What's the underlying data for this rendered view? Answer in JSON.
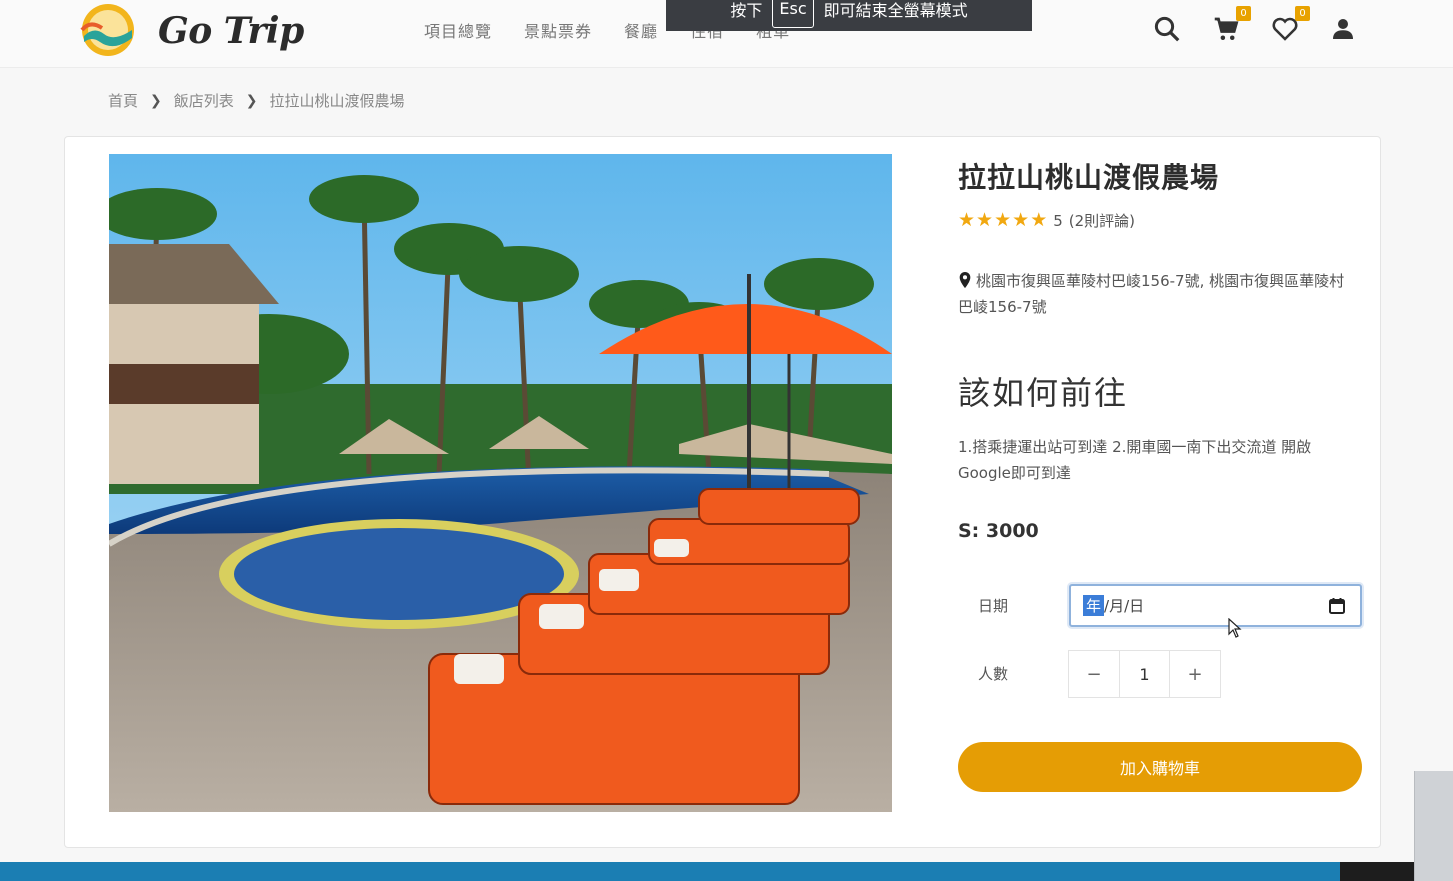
{
  "header": {
    "brand": "Go Trip",
    "nav": [
      {
        "label": "項目總覽"
      },
      {
        "label": "景點票券"
      },
      {
        "label": "餐廳"
      },
      {
        "label": "住宿"
      },
      {
        "label": "租車"
      }
    ],
    "cart_count": "0",
    "wishlist_count": "0",
    "icons": [
      "search-icon",
      "cart-icon",
      "heart-icon",
      "user-icon"
    ]
  },
  "toast": {
    "prefix": "按下",
    "key": "Esc",
    "suffix": "即可結束全螢幕模式"
  },
  "breadcrumb": {
    "items": [
      "首頁",
      "飯店列表",
      "拉拉山桃山渡假農場"
    ]
  },
  "product": {
    "title": "拉拉山桃山渡假農場",
    "rating_value": "5",
    "stars": 5,
    "review_text": "(2則評論)",
    "address": "桃園市復興區華陵村巴崚156-7號, 桃園市復興區華陵村巴崚156-7號",
    "how_title": "該如何前往",
    "how_body": "1.搭乘捷運出站可到達 2.開車國一南下出交流道 開啟Google即可到達",
    "price": "S: 3000"
  },
  "booking": {
    "date_label": "日期",
    "date_year_seg": "年",
    "date_rest": "/月/日",
    "people_label": "人數",
    "minus": "−",
    "quantity": "1",
    "plus": "+",
    "add_to_cart": "加入購物車"
  },
  "colors": {
    "accent": "#e59d05",
    "badge": "#e8a200",
    "star": "#f1a811",
    "footer": "#1b7eb3"
  }
}
